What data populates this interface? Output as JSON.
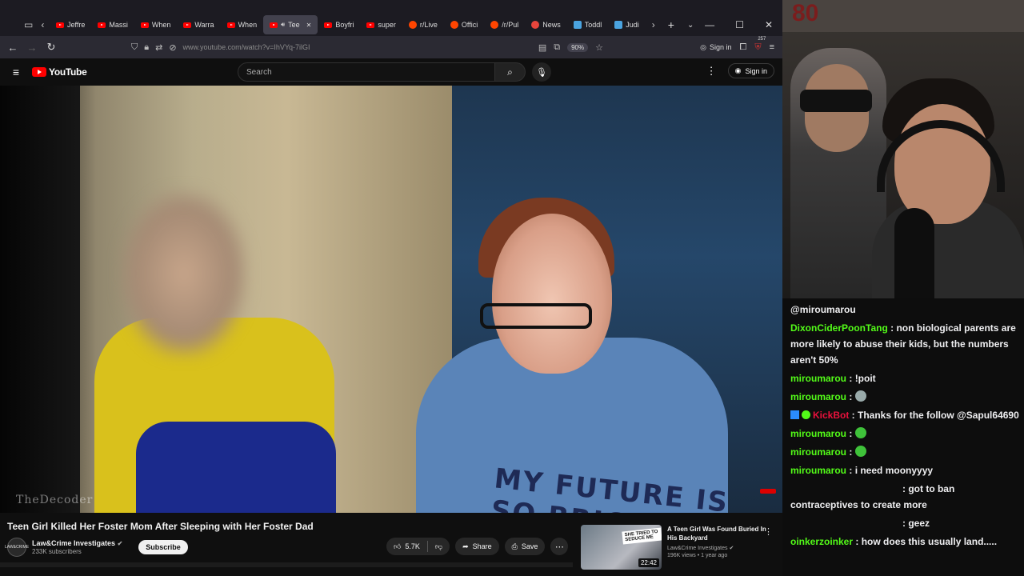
{
  "browser": {
    "tabs": [
      {
        "label": "Jeffre",
        "icon": "youtube"
      },
      {
        "label": "Massi",
        "icon": "youtube"
      },
      {
        "label": "When",
        "icon": "youtube"
      },
      {
        "label": "Warra",
        "icon": "youtube"
      },
      {
        "label": "When",
        "icon": "youtube"
      },
      {
        "label": "Tee",
        "icon": "youtube",
        "active": true
      },
      {
        "label": "Boyfri",
        "icon": "youtube"
      },
      {
        "label": "super",
        "icon": "youtube"
      },
      {
        "label": "r/Live",
        "icon": "reddit"
      },
      {
        "label": "Offici",
        "icon": "reddit"
      },
      {
        "label": "/r/Pul",
        "icon": "reddit"
      },
      {
        "label": "News",
        "icon": "news"
      },
      {
        "label": "Toddl",
        "icon": "generic"
      },
      {
        "label": "Judi",
        "icon": "generic"
      }
    ],
    "url": "www.youtube.com/watch?v=IhVYq-7ilGI",
    "zoom": "90%",
    "signin_label": "Sign in",
    "extension_badge": "257"
  },
  "youtube": {
    "logo_text": "YouTube",
    "search_placeholder": "Search",
    "signin_label": "Sign in",
    "video": {
      "watermark": "TheDecoder",
      "shirt_text": "MY FUTURE IS SO BRIGHT"
    },
    "title": "Teen Girl Killed Her Foster Mom After Sleeping with Her Foster Dad",
    "channel": {
      "name": "Law&Crime Investigates",
      "subscribers": "233K subscribers",
      "avatar_text": "LAW&CRIME"
    },
    "subscribe_label": "Subscribe",
    "likes": "5.7K",
    "share_label": "Share",
    "save_label": "Save",
    "recommended": {
      "title": "A Teen Girl Was Found Buried In His Backyard",
      "channel": "Law&Crime Investigates",
      "meta": "196K views • 1 year ago",
      "duration": "22:42",
      "thumb_text": "SHE TRIED TO SEDUCE ME"
    }
  },
  "chat": {
    "messages": [
      {
        "user": "",
        "text": "@miroumarou",
        "color": "#efeff1"
      },
      {
        "user": "DixonCiderPoonTang",
        "text": "non biological parents are more likely to abuse their kids, but the numbers aren't 50%",
        "color": "#53fc18"
      },
      {
        "user": "miroumarou",
        "text": "!poit",
        "color": "#53fc18"
      },
      {
        "user": "miroumarou",
        "text": "",
        "emote": "gray",
        "color": "#53fc18"
      },
      {
        "user": "KickBot",
        "text": "Thanks for the follow @Sapul64690",
        "color": "#e9113c",
        "badges": true
      },
      {
        "user": "miroumarou",
        "text": "",
        "emote": "green",
        "color": "#53fc18"
      },
      {
        "user": "miroumarou",
        "text": "",
        "emote": "green",
        "color": "#53fc18"
      },
      {
        "user": "miroumarou",
        "text": "i need moonyyyy",
        "color": "#53fc18"
      },
      {
        "user": "",
        "text": ": got to ban contraceptives to create more",
        "color": "#efeff1",
        "indent": true
      },
      {
        "user": "",
        "text": ": geez",
        "color": "#efeff1",
        "indent": true
      },
      {
        "user": "oinkerzoinker",
        "text": "how does this usually land.....",
        "color": "#53fc18"
      }
    ]
  },
  "webcam": {
    "logo_text": "80"
  }
}
